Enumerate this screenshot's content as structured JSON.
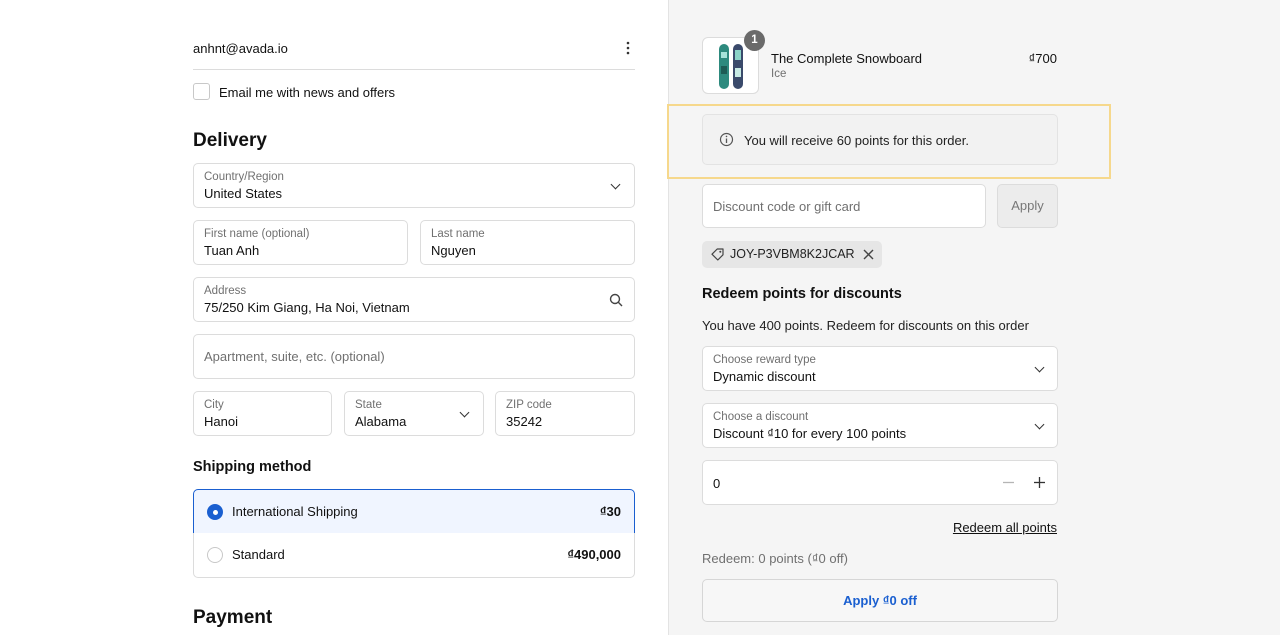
{
  "account": {
    "email": "anhnt@avada.io"
  },
  "newsletter": {
    "label": "Email me with news and offers"
  },
  "delivery": {
    "title": "Delivery",
    "country": {
      "label": "Country/Region",
      "value": "United States"
    },
    "first_name": {
      "label": "First name (optional)",
      "value": "Tuan Anh"
    },
    "last_name": {
      "label": "Last name",
      "value": "Nguyen"
    },
    "address": {
      "label": "Address",
      "value": "75/250 Kim Giang, Ha Noi, Vietnam"
    },
    "apartment": {
      "placeholder": "Apartment, suite, etc. (optional)"
    },
    "city": {
      "label": "City",
      "value": "Hanoi"
    },
    "state": {
      "label": "State",
      "value": "Alabama"
    },
    "zip": {
      "label": "ZIP code",
      "value": "35242"
    }
  },
  "shipping": {
    "title": "Shipping method",
    "options": [
      {
        "label": "International Shipping",
        "price": "₫30",
        "selected": true
      },
      {
        "label": "Standard",
        "price": "₫490,000",
        "selected": false
      }
    ]
  },
  "payment": {
    "title": "Payment"
  },
  "cart": {
    "item": {
      "name": "The Complete Snowboard",
      "variant": "Ice",
      "price": "₫700",
      "quantity": "1"
    }
  },
  "points_notice": {
    "text": "You will receive 60 points for this order."
  },
  "discount": {
    "placeholder": "Discount code or gift card",
    "apply_label": "Apply",
    "applied_code": "JOY-P3VBM8K2JCAR"
  },
  "redeem": {
    "title": "Redeem points for discounts",
    "subtitle": "You have 400 points. Redeem for discounts on this order",
    "reward_type": {
      "label": "Choose reward type",
      "value": "Dynamic discount"
    },
    "discount_choice": {
      "label": "Choose a discount",
      "value": "Discount ₫10 for every 100 points"
    },
    "amount": "0",
    "redeem_all_label": "Redeem all points",
    "summary": "Redeem: 0 points (₫0 off)",
    "apply_button": "Apply ₫0 off"
  },
  "colors": {
    "accent": "#1a5fd0",
    "highlight_border": "#f6d88c",
    "panel_bg": "#f5f5f5"
  }
}
